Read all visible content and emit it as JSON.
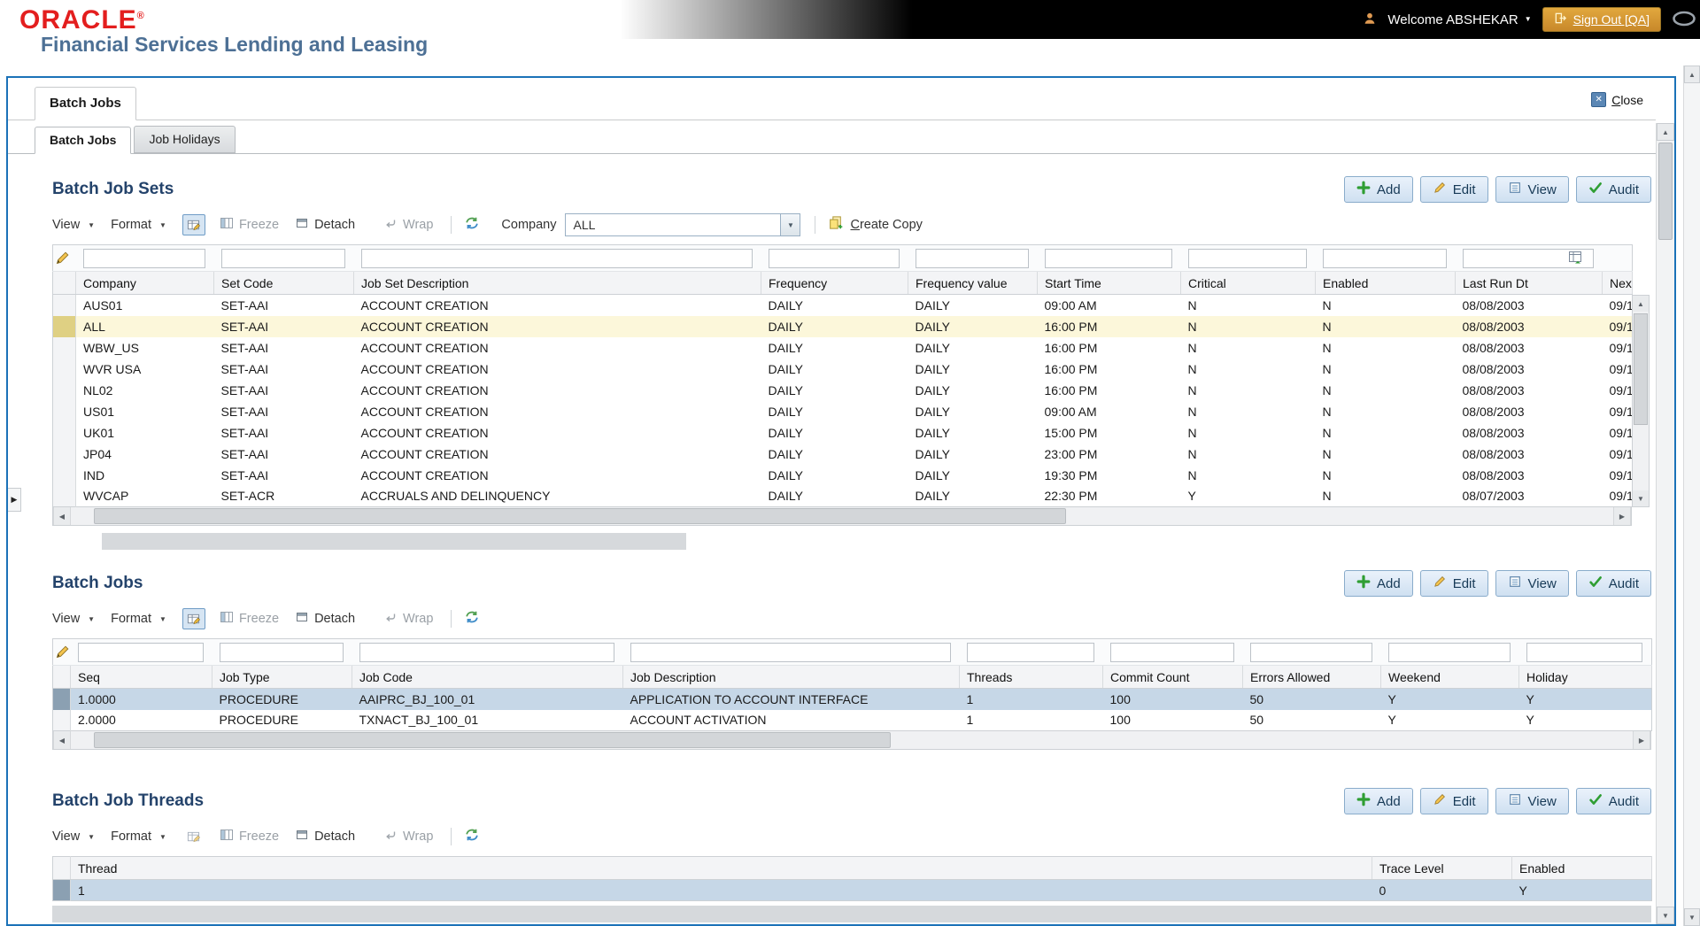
{
  "glyphs": {
    "caret_down": "▼",
    "arrow_up": "▲",
    "arrow_down": "▼",
    "arrow_left": "◀",
    "arrow_right": "▶",
    "panel_handle": "▶",
    "close_x": "✕"
  },
  "header": {
    "logo": "ORACLE",
    "logo_mark": "®",
    "subtitle": "Financial Services Lending and Leasing",
    "welcome": "Welcome ABSHEKAR",
    "sign_out": "Sign Out [QA]"
  },
  "window": {
    "title_tab": "Batch Jobs",
    "close": "Close",
    "subtab_active": "Batch Jobs",
    "subtab_inactive": "Job Holidays"
  },
  "actions": {
    "add": "Add",
    "edit": "Edit",
    "view": "View",
    "audit": "Audit"
  },
  "toolbar": {
    "view": "View",
    "format": "Format",
    "freeze": "Freeze",
    "detach": "Detach",
    "wrap": "Wrap",
    "company_label": "Company",
    "company_value": "ALL",
    "create_copy": "Create Copy"
  },
  "job_sets": {
    "title": "Batch Job Sets",
    "columns": [
      "Company",
      "Set Code",
      "Job Set Description",
      "Frequency",
      "Frequency value",
      "Start Time",
      "Critical",
      "Enabled",
      "Last Run Dt",
      "Next"
    ],
    "rows": [
      [
        "AUS01",
        "SET-AAI",
        "ACCOUNT CREATION",
        "DAILY",
        "DAILY",
        "09:00 AM",
        "N",
        "N",
        "08/08/2003",
        "09/1"
      ],
      [
        "ALL",
        "SET-AAI",
        "ACCOUNT CREATION",
        "DAILY",
        "DAILY",
        "16:00 PM",
        "N",
        "N",
        "08/08/2003",
        "09/1"
      ],
      [
        "WBW_US",
        "SET-AAI",
        "ACCOUNT CREATION",
        "DAILY",
        "DAILY",
        "16:00 PM",
        "N",
        "N",
        "08/08/2003",
        "09/1"
      ],
      [
        "WVR USA",
        "SET-AAI",
        "ACCOUNT CREATION",
        "DAILY",
        "DAILY",
        "16:00 PM",
        "N",
        "N",
        "08/08/2003",
        "09/1"
      ],
      [
        "NL02",
        "SET-AAI",
        "ACCOUNT CREATION",
        "DAILY",
        "DAILY",
        "16:00 PM",
        "N",
        "N",
        "08/08/2003",
        "09/1"
      ],
      [
        "US01",
        "SET-AAI",
        "ACCOUNT CREATION",
        "DAILY",
        "DAILY",
        "09:00 AM",
        "N",
        "N",
        "08/08/2003",
        "09/1"
      ],
      [
        "UK01",
        "SET-AAI",
        "ACCOUNT CREATION",
        "DAILY",
        "DAILY",
        "15:00 PM",
        "N",
        "N",
        "08/08/2003",
        "09/1"
      ],
      [
        "JP04",
        "SET-AAI",
        "ACCOUNT CREATION",
        "DAILY",
        "DAILY",
        "23:00 PM",
        "N",
        "N",
        "08/08/2003",
        "09/1"
      ],
      [
        "IND",
        "SET-AAI",
        "ACCOUNT CREATION",
        "DAILY",
        "DAILY",
        "19:30 PM",
        "N",
        "N",
        "08/08/2003",
        "09/1"
      ],
      [
        "WVCAP",
        "SET-ACR",
        "ACCRUALS AND DELINQUENCY",
        "DAILY",
        "DAILY",
        "22:30 PM",
        "Y",
        "N",
        "08/07/2003",
        "09/1"
      ]
    ]
  },
  "jobs": {
    "title": "Batch Jobs",
    "columns": [
      "Seq",
      "Job Type",
      "Job Code",
      "Job Description",
      "Threads",
      "Commit Count",
      "Errors Allowed",
      "Weekend",
      "Holiday"
    ],
    "rows": [
      [
        "1.0000",
        "PROCEDURE",
        "AAIPRC_BJ_100_01",
        "APPLICATION TO ACCOUNT INTERFACE",
        "1",
        "100",
        "50",
        "Y",
        "Y"
      ],
      [
        "2.0000",
        "PROCEDURE",
        "TXNACT_BJ_100_01",
        "ACCOUNT ACTIVATION",
        "1",
        "100",
        "50",
        "Y",
        "Y"
      ]
    ]
  },
  "threads": {
    "title": "Batch Job Threads",
    "columns": [
      "Thread",
      "Trace Level",
      "Enabled"
    ],
    "rows": [
      [
        "1",
        "0",
        "Y"
      ]
    ]
  }
}
